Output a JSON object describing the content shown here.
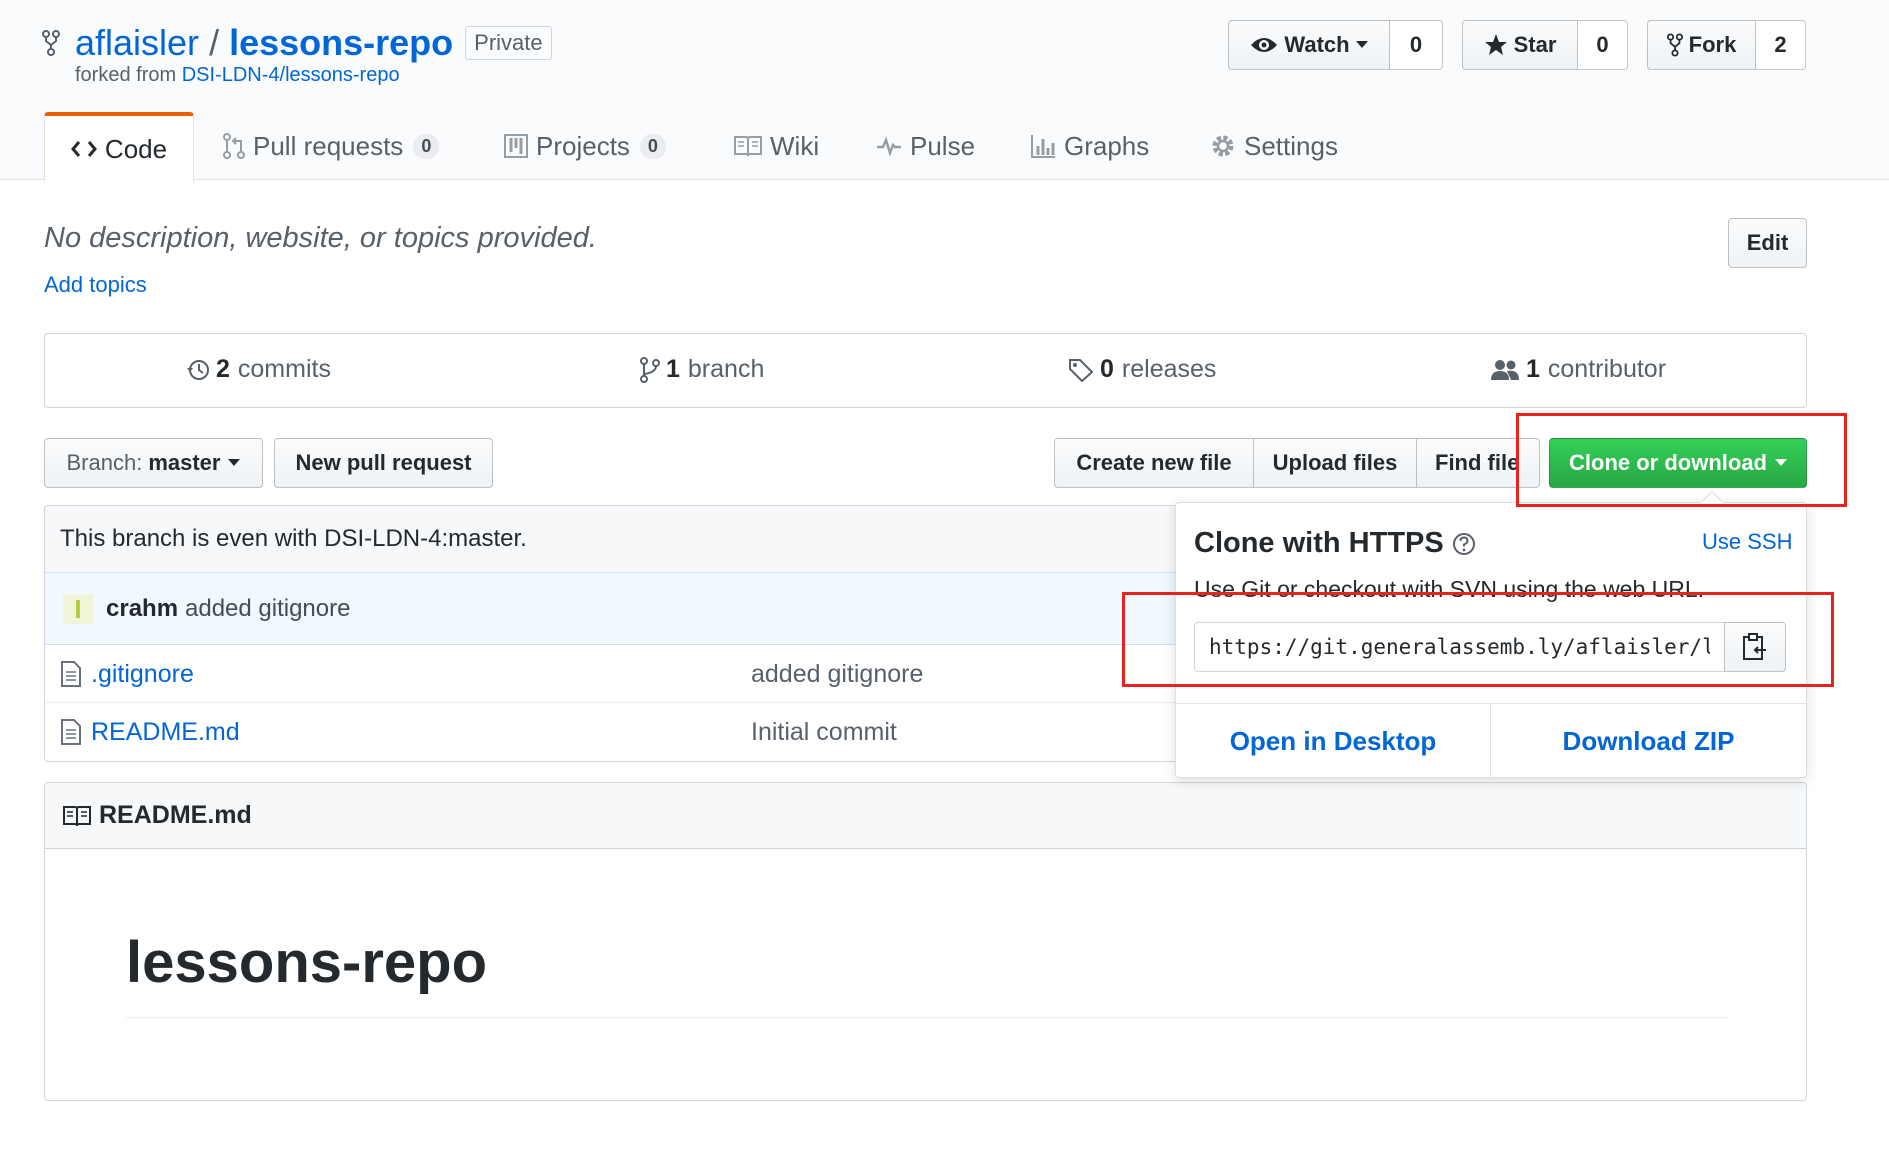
{
  "repo": {
    "owner": "aflaisler",
    "separator": "/",
    "name": "lessons-repo",
    "visibility": "Private",
    "forked_prefix": "forked from",
    "forked_source": "DSI-LDN-4/lessons-repo"
  },
  "actions": {
    "watch_label": "Watch",
    "watch_count": "0",
    "star_label": "Star",
    "star_count": "0",
    "fork_label": "Fork",
    "fork_count": "2"
  },
  "tabs": [
    {
      "label": "Code",
      "icon": "code-icon"
    },
    {
      "label": "Pull requests",
      "count": "0",
      "icon": "git-pull-request-icon"
    },
    {
      "label": "Projects",
      "count": "0",
      "icon": "project-icon"
    },
    {
      "label": "Wiki",
      "icon": "book-icon"
    },
    {
      "label": "Pulse",
      "icon": "pulse-icon"
    },
    {
      "label": "Graphs",
      "icon": "graph-icon"
    },
    {
      "label": "Settings",
      "icon": "gear-icon"
    }
  ],
  "description": {
    "text": "No description, website, or topics provided.",
    "add_topics": "Add topics",
    "edit_label": "Edit"
  },
  "summary": {
    "commits_count": "2",
    "commits_label": "commits",
    "branch_count": "1",
    "branch_label": "branch",
    "releases_count": "0",
    "releases_label": "releases",
    "contributor_count": "1",
    "contributor_label": "contributor"
  },
  "file_nav": {
    "branch_prefix": "Branch:",
    "branch_name": "master",
    "new_pull_request": "New pull request",
    "create_new_file": "Create new file",
    "upload_files": "Upload files",
    "find_file": "Find file",
    "clone_or_download": "Clone or download"
  },
  "branch_status": "This branch is even with DSI-LDN-4:master.",
  "latest_commit": {
    "author": "crahm",
    "message": "added gitignore",
    "avatar_letter": "I"
  },
  "files": [
    {
      "name": ".gitignore",
      "message": "added gitignore"
    },
    {
      "name": "README.md",
      "message": "Initial commit"
    }
  ],
  "clone_popup": {
    "title": "Clone with HTTPS",
    "use_ssh": "Use SSH",
    "description": "Use Git or checkout with SVN using the web URL.",
    "url": "https://git.generalassemb.ly/aflaisler/lessons-repo.git",
    "open_desktop": "Open in Desktop",
    "download_zip": "Download ZIP"
  },
  "readme": {
    "header": "README.md",
    "heading": "lessons-repo"
  },
  "colors": {
    "link": "#0366d6",
    "primary_button": "#28a745",
    "tab_accent": "#e36209",
    "annotation_red": "#e8231d"
  }
}
